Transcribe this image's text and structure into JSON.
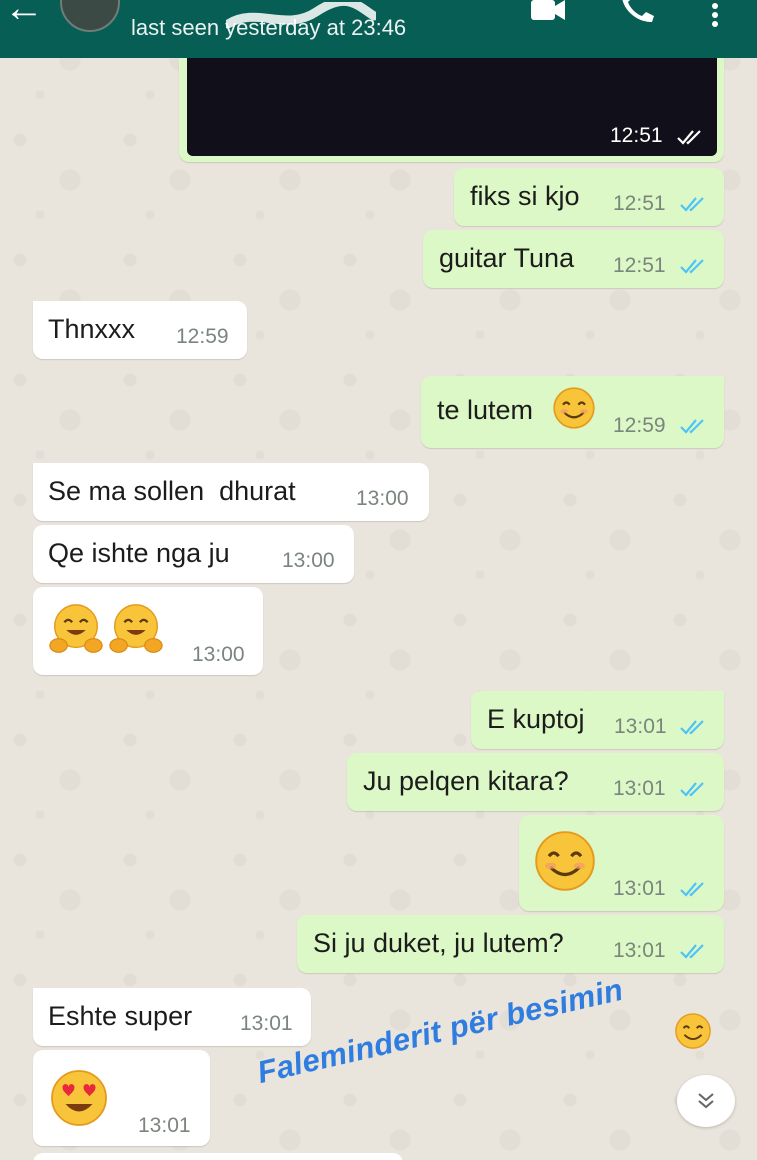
{
  "header": {
    "last_seen": "last seen yesterday at 23:46"
  },
  "messages": [
    {
      "id": "m0",
      "direction": "out",
      "type": "media",
      "time": "12:51",
      "status": "read"
    },
    {
      "id": "m1",
      "direction": "out",
      "text": "fiks si kjo",
      "time": "12:51",
      "status": "read"
    },
    {
      "id": "m2",
      "direction": "out",
      "text": "guitar Tuna",
      "time": "12:51",
      "status": "read"
    },
    {
      "id": "m3",
      "direction": "in",
      "text": "Thnxxx",
      "time": "12:59"
    },
    {
      "id": "m4",
      "direction": "out",
      "text": "te lutem",
      "emoji": "smiling-face",
      "time": "12:59",
      "status": "read"
    },
    {
      "id": "m5",
      "direction": "in",
      "text": "Se ma sollen  dhurat",
      "time": "13:00"
    },
    {
      "id": "m6",
      "direction": "in",
      "text": "Qe ishte nga ju",
      "time": "13:00"
    },
    {
      "id": "m7",
      "direction": "in",
      "emoji": "hugging-face x2",
      "time": "13:00"
    },
    {
      "id": "m8",
      "direction": "out",
      "text": "E kuptoj",
      "time": "13:01",
      "status": "read"
    },
    {
      "id": "m9",
      "direction": "out",
      "text": "Ju pelqen kitara?",
      "time": "13:01",
      "status": "read"
    },
    {
      "id": "m10",
      "direction": "out",
      "emoji": "smiling-face",
      "time": "13:01",
      "status": "read"
    },
    {
      "id": "m11",
      "direction": "out",
      "text": "Si ju duket, ju lutem?",
      "time": "13:01",
      "status": "read"
    },
    {
      "id": "m12",
      "direction": "in",
      "text": "Eshte super",
      "time": "13:01"
    },
    {
      "id": "m13",
      "direction": "in",
      "emoji": "heart-eyes-face",
      "time": "13:01"
    }
  ],
  "overlay": {
    "caption": "Faleminderit për besimin",
    "caption_emoji": "smiling-face"
  },
  "colors": {
    "header": "#075e54",
    "bubble_out": "#dcf8c6",
    "bubble_in": "#ffffff",
    "read_ticks": "#4fc3f7",
    "caption": "#2f7de1"
  }
}
